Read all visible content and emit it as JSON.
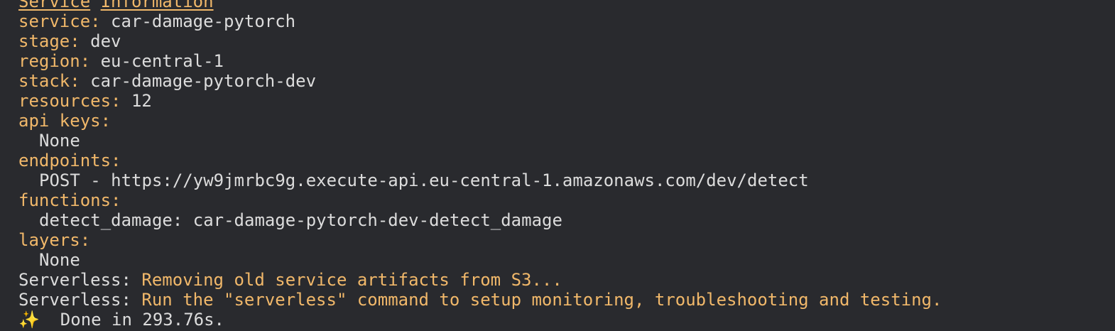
{
  "terminal": {
    "heading": {
      "word1": "Service",
      "word2": "Information"
    },
    "service": {
      "key": "service:",
      "value": "car-damage-pytorch"
    },
    "stage": {
      "key": "stage:",
      "value": "dev"
    },
    "region": {
      "key": "region:",
      "value": "eu-central-1"
    },
    "stack": {
      "key": "stack:",
      "value": "car-damage-pytorch-dev"
    },
    "resources": {
      "key": "resources:",
      "value": "12"
    },
    "api_keys": {
      "key": "api keys:",
      "value": "None"
    },
    "endpoints": {
      "key": "endpoints:",
      "method": "POST",
      "separator": "-",
      "url": "https://yw9jmrbc9g.execute-api.eu-central-1.amazonaws.com/dev/detect"
    },
    "functions": {
      "key": "functions:",
      "name": "detect_damage:",
      "value": "car-damage-pytorch-dev-detect_damage"
    },
    "layers": {
      "key": "layers:",
      "value": "None"
    },
    "log": [
      {
        "prefix": "Serverless:",
        "message": "Removing old service artifacts from S3..."
      },
      {
        "prefix": "Serverless:",
        "message": "Run the \"serverless\" command to setup monitoring, troubleshooting and testing."
      }
    ],
    "done": {
      "icon": "sparkles-icon",
      "glyph": "✨",
      "text": "Done in 293.76s."
    }
  },
  "colors": {
    "background": "#292a2e",
    "text": "#dcdcdc",
    "accent": "#f1b86a"
  }
}
